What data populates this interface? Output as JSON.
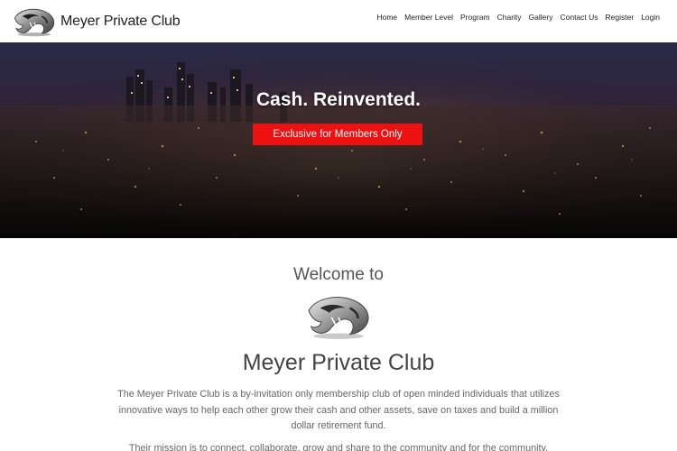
{
  "header": {
    "brand_name": "Meyer Private Club",
    "logo_icon": "panther-logo-icon",
    "nav": [
      {
        "label": "Home"
      },
      {
        "label": "Member Level"
      },
      {
        "label": "Program"
      },
      {
        "label": "Charity"
      },
      {
        "label": "Gallery"
      },
      {
        "label": "Contact Us"
      },
      {
        "label": "Register"
      },
      {
        "label": "Login"
      }
    ]
  },
  "hero": {
    "title": "Cash. Reinvented.",
    "cta_label": "Exclusive for Members Only",
    "cta_color": "#ee1111",
    "background": "night-city-skyline-image"
  },
  "welcome": {
    "heading": "Welcome to",
    "logo_icon": "panther-logo-icon",
    "club_name": "Meyer Private Club",
    "description": "The Meyer Private Club is a by-invitation only membership club of open minded individuals that utilizes innovative ways to help each other grow their cash and other assets, save on taxes and build a million dollar retirement fund.",
    "mission": "Their mission is to connect, collaborate, grow and share to the community and for the community."
  }
}
